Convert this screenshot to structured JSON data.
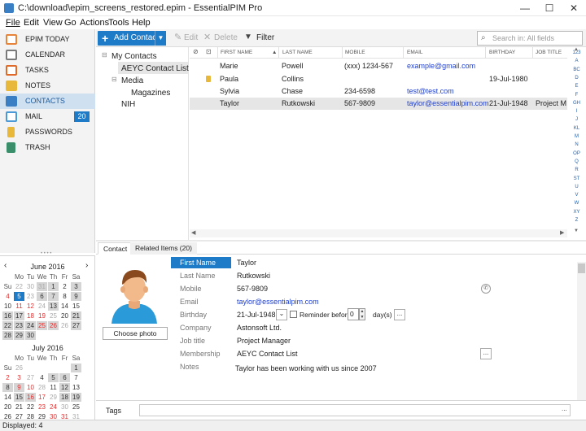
{
  "window": {
    "title": "C:\\download\\epim_screens_restored.epim - EssentialPIM Pro",
    "minimize": "—",
    "maximize": "☐",
    "close": "✕"
  },
  "menu": [
    "File",
    "Edit",
    "View",
    "Go",
    "Actions",
    "Tools",
    "Help"
  ],
  "toolbar": {
    "add": "Add Contact",
    "edit": "Edit",
    "delete": "Delete",
    "filter": "Filter",
    "search_placeholder": "Search in: All fields"
  },
  "nav": [
    {
      "label": "EPIM TODAY",
      "icon": "home-icon",
      "color": "#e8833a"
    },
    {
      "label": "CALENDAR",
      "icon": "calendar-icon",
      "color": "#7a7a7a"
    },
    {
      "label": "TASKS",
      "icon": "checkbox-icon",
      "color": "#e06a2a"
    },
    {
      "label": "NOTES",
      "icon": "note-icon",
      "color": "#e8b83a"
    },
    {
      "label": "CONTACTS",
      "icon": "contacts-icon",
      "color": "#3a7fc4"
    },
    {
      "label": "MAIL",
      "icon": "mail-icon",
      "color": "#4a9ad8",
      "badge": "20"
    },
    {
      "label": "PASSWORDS",
      "icon": "key-icon",
      "color": "#e8b83a"
    },
    {
      "label": "TRASH",
      "icon": "trash-icon",
      "color": "#3a8f6a"
    }
  ],
  "cal1": {
    "month": "June  2016",
    "days": [
      "Mo",
      "Tu",
      "We",
      "Th",
      "Fr",
      "Sa",
      "Su"
    ]
  },
  "cal2": {
    "month": "July  2016",
    "days": [
      "Mo",
      "Tu",
      "We",
      "Th",
      "Fr",
      "Sa",
      "Su"
    ]
  },
  "tree": {
    "root": "My Contacts",
    "items": [
      "AEYC Contact List",
      "Media",
      "Magazines",
      "NIH"
    ]
  },
  "columns": [
    "FIRST NAME",
    "LAST NAME",
    "MOBILE",
    "EMAIL",
    "BIRTHDAY",
    "JOB TITLE"
  ],
  "rows": [
    {
      "first": "Marie",
      "last": "Powell",
      "mobile": "(xxx) 1234-567",
      "email": "example@gmail.com",
      "birthday": "",
      "job": ""
    },
    {
      "first": "Paula",
      "last": "Collins",
      "mobile": "",
      "email": "",
      "birthday": "19-Jul-1980",
      "job": ""
    },
    {
      "first": "Sylvia",
      "last": "Chase",
      "mobile": "234-6598",
      "email": "test@test.com",
      "birthday": "",
      "job": ""
    },
    {
      "first": "Taylor",
      "last": "Rutkowski",
      "mobile": "567-9809",
      "email": "taylor@essentialpim.com",
      "birthday": "21-Jul-1948",
      "job": "Project Ma"
    }
  ],
  "alphabet": [
    "123",
    "A",
    "BC",
    "D",
    "E",
    "F",
    "GH",
    "I",
    "J",
    "KL",
    "M",
    "N",
    "OP",
    "Q",
    "R",
    "ST",
    "U",
    "V",
    "W",
    "XY",
    "Z"
  ],
  "tabs": {
    "contact": "Contact",
    "related": "Related Items  (20)"
  },
  "detail": {
    "photo_button": "Choose photo",
    "first_name_label": "First Name",
    "first_name": "Taylor",
    "last_name_label": "Last Name",
    "last_name": "Rutkowski",
    "mobile_label": "Mobile",
    "mobile": "567-9809",
    "email_label": "Email",
    "email": "taylor@essentialpim.com",
    "birthday_label": "Birthday",
    "birthday": "21-Jul-1948",
    "reminder_label": "Reminder before",
    "reminder_value": "0",
    "days_label": "day(s)",
    "company_label": "Company",
    "company": "Astonsoft Ltd.",
    "job_label": "Job title",
    "job": "Project Manager",
    "membership_label": "Membership",
    "membership": "AEYC Contact List",
    "notes_label": "Notes",
    "notes": "Taylor has been working with us since 2007",
    "more": "...",
    "chevron": "⌄"
  },
  "tags_label": "Tags",
  "status": "Displayed: 4"
}
